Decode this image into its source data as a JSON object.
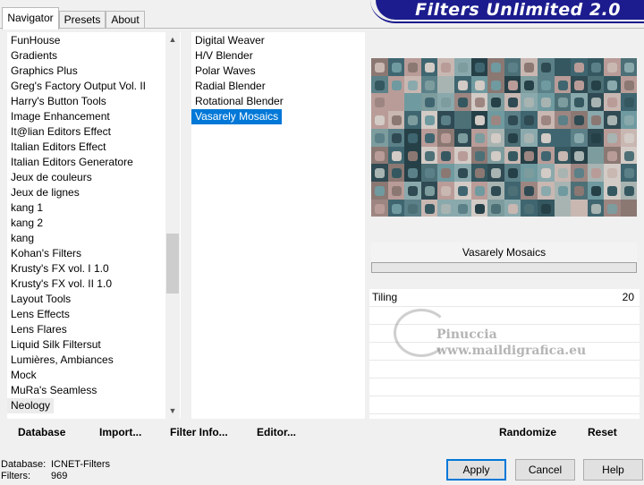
{
  "tabs": [
    {
      "label": "Navigator",
      "active": true
    },
    {
      "label": "Presets",
      "active": false
    },
    {
      "label": "About",
      "active": false
    }
  ],
  "banner": {
    "title": "Filters Unlimited 2.0",
    "color": "#1c1c8e"
  },
  "categories": {
    "items": [
      "FunHouse",
      "Gradients",
      "Graphics Plus",
      "Greg's Factory Output Vol. II",
      "Harry's Button Tools",
      "Image Enhancement",
      "It@lian Editors Effect",
      "Italian Editors Effect",
      "Italian Editors Generatore",
      "Jeux de couleurs",
      "Jeux de lignes",
      "kang 1",
      "kang 2",
      "kang",
      "Kohan's Filters",
      "Krusty's FX vol. I 1.0",
      "Krusty's FX vol. II 1.0",
      "Layout Tools",
      "Lens Effects",
      "Lens Flares",
      "Liquid Silk Filtersut",
      "Lumières, Ambiances",
      "Mock",
      "MuRa's Seamless",
      "Neology"
    ],
    "highlighted": "Neology"
  },
  "filters": {
    "items": [
      "Digital Weaver",
      "H/V Blender",
      "Polar Waves",
      "Radial Blender",
      "Rotational Blender",
      "Vasarely Mosaics"
    ],
    "selected": "Vasarely Mosaics"
  },
  "filter_name": "Vasarely Mosaics",
  "params": [
    {
      "label": "Tiling",
      "value": "20"
    }
  ],
  "watermark": {
    "line1": "Pinuccia",
    "line2": "www.maildigrafica.eu"
  },
  "left_buttons": [
    "Database",
    "Import...",
    "Filter Info...",
    "Editor..."
  ],
  "right_buttons": [
    "Randomize",
    "Reset"
  ],
  "status": {
    "database_label": "Database:",
    "database_value": "ICNET-Filters",
    "filters_label": "Filters:",
    "filters_value": "969"
  },
  "dialog_buttons": {
    "apply": "Apply",
    "cancel": "Cancel",
    "help": "Help"
  },
  "colors": {
    "selection": "#0078d7",
    "accent": "#1c1c8e"
  }
}
